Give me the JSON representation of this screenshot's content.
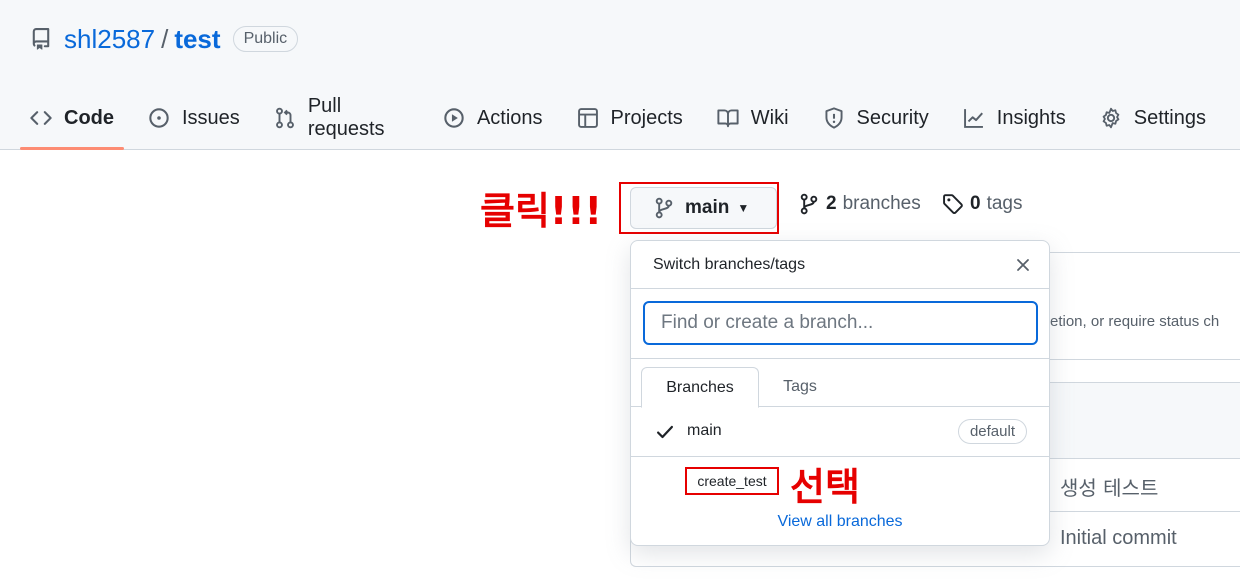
{
  "repo": {
    "owner": "shl2587",
    "separator": "/",
    "name": "test",
    "visibility": "Public"
  },
  "tabs": [
    {
      "label": "Code",
      "icon": "code-icon",
      "selected": true
    },
    {
      "label": "Issues",
      "icon": "issue-icon"
    },
    {
      "label": "Pull requests",
      "icon": "pull-request-icon"
    },
    {
      "label": "Actions",
      "icon": "play-icon"
    },
    {
      "label": "Projects",
      "icon": "table-icon"
    },
    {
      "label": "Wiki",
      "icon": "book-icon"
    },
    {
      "label": "Security",
      "icon": "shield-icon"
    },
    {
      "label": "Insights",
      "icon": "graph-icon"
    },
    {
      "label": "Settings",
      "icon": "gear-icon"
    }
  ],
  "annotations": {
    "click": "클릭!!!",
    "select": "선택"
  },
  "branch_button": {
    "label": "main"
  },
  "meta": {
    "branches_count": "2",
    "branches_label": "branches",
    "tags_count": "0",
    "tags_label": "tags"
  },
  "background": {
    "panel_text": "etion, or require status ch",
    "commit_1": "생성 테스트",
    "commit_2": "Initial commit"
  },
  "dropdown": {
    "title": "Switch branches/tags",
    "filter_placeholder": "Find or create a branch...",
    "filter_value": "",
    "tab_branches": "Branches",
    "tab_tags": "Tags",
    "items": [
      {
        "label": "main",
        "badge": "default",
        "checked": true
      },
      {
        "label": "create_test"
      }
    ],
    "view_all": "View all branches"
  },
  "colors": {
    "accent": "#0969da",
    "annotation_red": "#e60000",
    "tab_underline": "#fd8c73"
  }
}
